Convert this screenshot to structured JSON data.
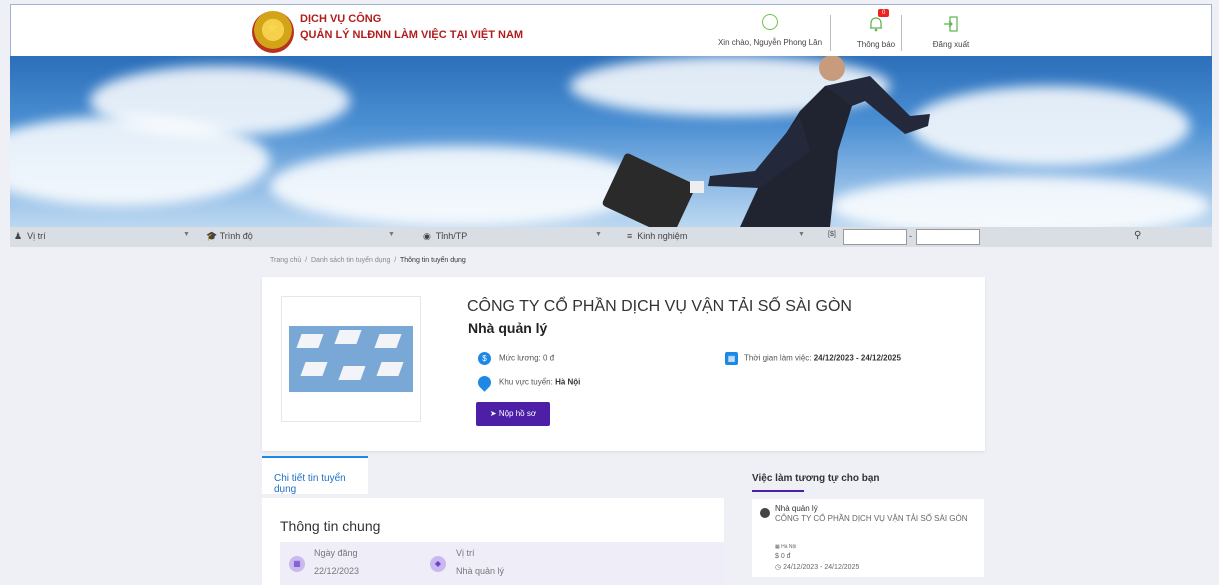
{
  "header": {
    "brand_line1": "DỊCH VỤ CÔNG",
    "brand_line2": "QUẢN LÝ NLĐNN LÀM VIỆC TẠI VIỆT NAM",
    "greeting": "Xin chào, Nguyễn Phong Lân",
    "notifications_label": "Thông báo",
    "notifications_count": "0",
    "logout_label": "Đăng xuất"
  },
  "filters": {
    "position": "Vị trí",
    "education": "Trình độ",
    "province": "Tỉnh/TP",
    "experience": "Kinh nghiệm",
    "range_separator": "-"
  },
  "breadcrumb": {
    "home": "Trang chủ",
    "list": "Danh sách tin tuyển dụng",
    "current": "Thông tin tuyển dụng",
    "sep": "/"
  },
  "job": {
    "company": "CÔNG TY CỔ PHẦN DỊCH VỤ VẬN TẢI SỐ SÀI GÒN",
    "title": "Nhà quản lý",
    "salary_label": "Mức lương: 0 đ",
    "area_label": "Khu vực tuyển:",
    "area_value": "Hà Nội",
    "time_label": "Thời gian làm việc:",
    "time_value": "24/12/2023 - 24/12/2025",
    "apply_button": "Nộp hồ sơ"
  },
  "tabs": {
    "detail": "Chi tiết tin tuyển dụng"
  },
  "general": {
    "heading": "Thông tin chung",
    "post_date_label": "Ngày đăng",
    "post_date_value": "22/12/2023",
    "position_label": "Vị trí",
    "position_value": "Nhà quản lý"
  },
  "similar": {
    "heading": "Việc làm tương tự cho bạn",
    "items": [
      {
        "title": "Nhà quản lý",
        "company": "CÔNG TY CỔ PHẦN DỊCH VỤ VẬN TẢI SỐ SÀI GÒN",
        "location": "Hà Nội",
        "salary": "$ 0 đ",
        "dates": "24/12/2023 - 24/12/2025"
      }
    ]
  },
  "colors": {
    "brand_red": "#b11d1d",
    "accent_purple": "#4c1fa6",
    "accent_blue": "#1e88e5"
  }
}
